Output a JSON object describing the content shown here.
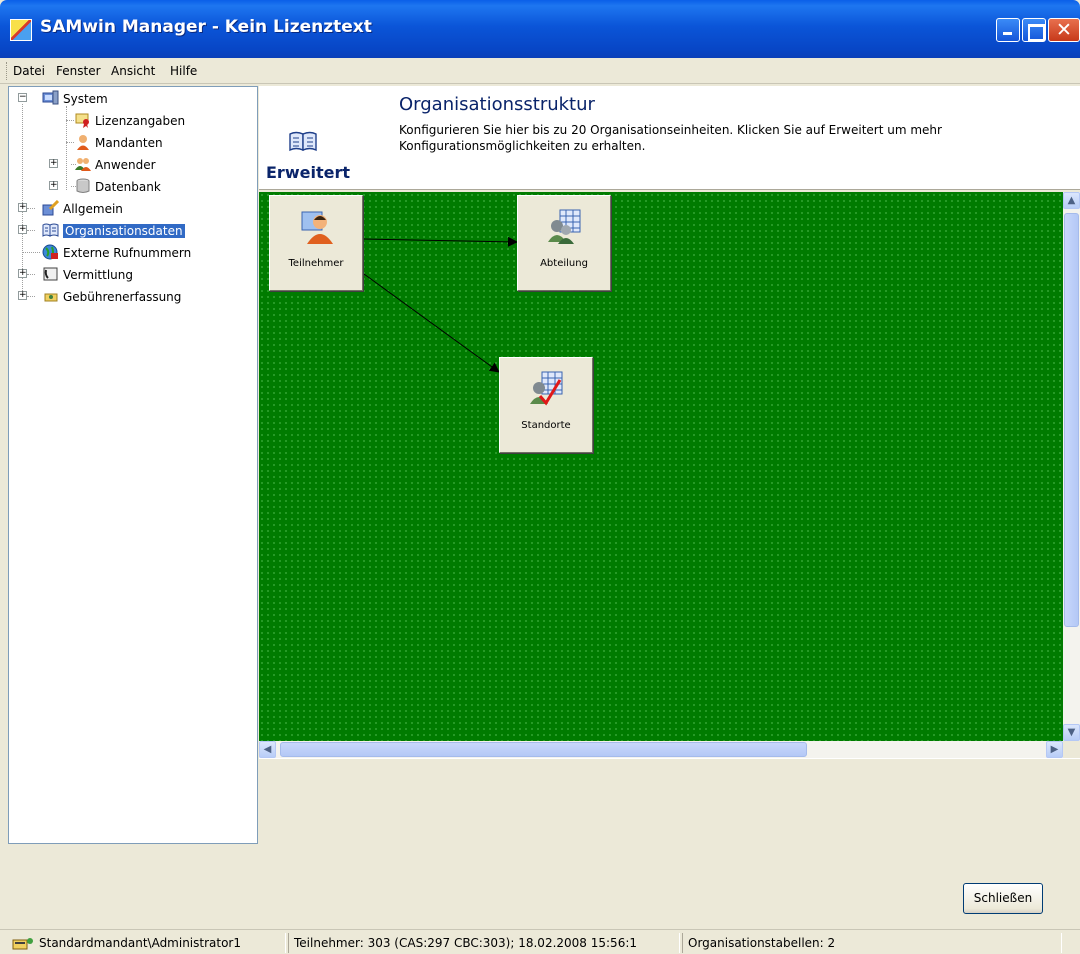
{
  "window": {
    "title": "SAMwin Manager - Kein Lizenztext",
    "close_glyph": "✕"
  },
  "menu": [
    "Datei",
    "Fenster",
    "Ansicht",
    "Hilfe"
  ],
  "tree": {
    "system": "System",
    "lizenzangaben": "Lizenzangaben",
    "mandanten": "Mandanten",
    "anwender": "Anwender",
    "datenbank": "Datenbank",
    "allgemein": "Allgemein",
    "organisationsdaten": "Organisationsdaten",
    "externe_rufnummern": "Externe Rufnummern",
    "vermittlung": "Vermittlung",
    "gebuehrenerfassung": "Gebührenerfassung",
    "expand_plus": "+",
    "expand_minus": "−"
  },
  "header": {
    "title": "Organisationsstruktur",
    "description": "Konfigurieren Sie hier bis zu 20 Organisationseinheiten. Klicken Sie auf Erweitert um mehr Konfigurationsmöglichkeiten zu erhalten.",
    "erweitert": "Erweitert"
  },
  "diagram": {
    "nodes": [
      "Teilnehmer",
      "Abteilung",
      "Standorte"
    ],
    "canvas_color": "#007b00"
  },
  "scroll": {
    "up": "▲",
    "down": "▼",
    "left": "◀",
    "right": "▶"
  },
  "buttons": {
    "close": "Schließen"
  },
  "status": {
    "user": "Standardmandant\\Administrator1",
    "info": "Teilnehmer: 303 (CAS:297 CBC:303); 18.02.2008 15:56:1",
    "tables": "Organisationstabellen: 2"
  }
}
